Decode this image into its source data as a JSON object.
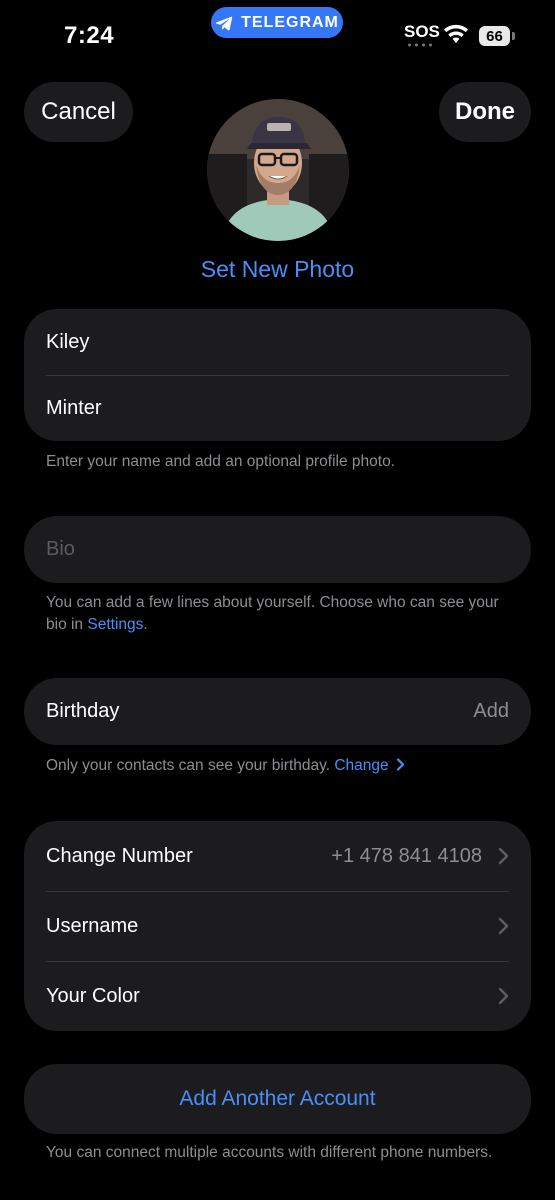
{
  "status_bar": {
    "time": "7:24",
    "app_pill": "TELEGRAM",
    "carrier": "SOS",
    "battery": "66"
  },
  "header": {
    "cancel_label": "Cancel",
    "done_label": "Done",
    "set_photo_label": "Set New Photo"
  },
  "name_group": {
    "first_name": "Kiley",
    "last_name": "Minter",
    "hint": "Enter your name and add an optional profile photo."
  },
  "bio_group": {
    "placeholder": "Bio",
    "hint_prefix": "You can add a few lines about yourself. Choose who can see your bio in ",
    "hint_link": "Settings",
    "hint_suffix": "."
  },
  "birthday_group": {
    "label": "Birthday",
    "value": "Add",
    "hint": "Only your contacts can see your birthday.",
    "hint_link": "Change"
  },
  "account_group": {
    "items": [
      {
        "label": "Change Number",
        "value": "+1 478 841 4108"
      },
      {
        "label": "Username",
        "value": ""
      },
      {
        "label": "Your Color",
        "value": ""
      }
    ]
  },
  "add_account": {
    "label": "Add Another Account",
    "hint": "You can connect multiple accounts with different phone numbers."
  },
  "colors": {
    "accent": "#4a8ef7",
    "background": "#000000",
    "cell": "#1c1c1e",
    "secondary_text": "#8d8d93"
  }
}
